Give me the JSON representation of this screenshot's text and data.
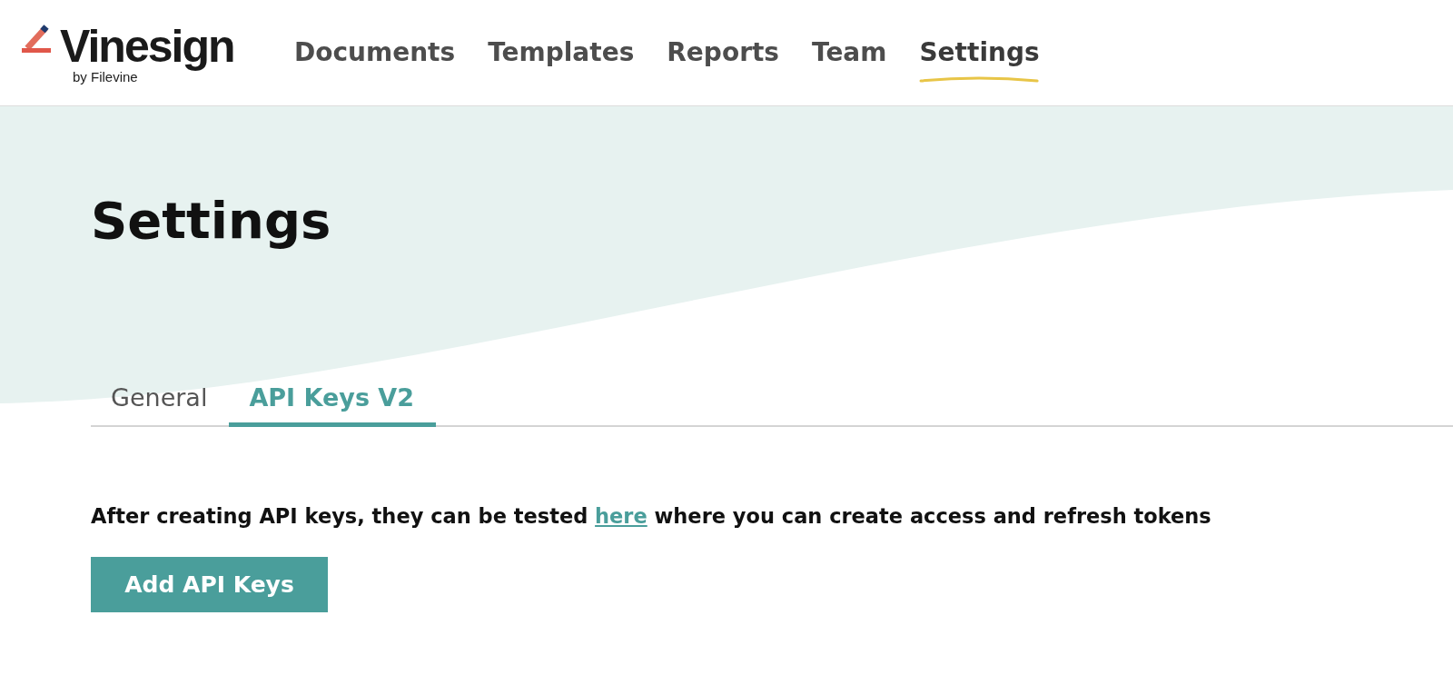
{
  "logo": {
    "name": "Vinesign",
    "tagline": "by Filevine"
  },
  "nav": [
    {
      "label": "Documents",
      "selected": false
    },
    {
      "label": "Templates",
      "selected": false
    },
    {
      "label": "Reports",
      "selected": false
    },
    {
      "label": "Team",
      "selected": false
    },
    {
      "label": "Settings",
      "selected": true
    }
  ],
  "page_title": "Settings",
  "tabs": [
    {
      "label": "General",
      "selected": false
    },
    {
      "label": "API Keys V2",
      "selected": true
    }
  ],
  "intro": {
    "before": "After creating API keys, they can be tested ",
    "link": "here",
    "after": " where you can create access and refresh tokens"
  },
  "add_button": "Add API Keys"
}
